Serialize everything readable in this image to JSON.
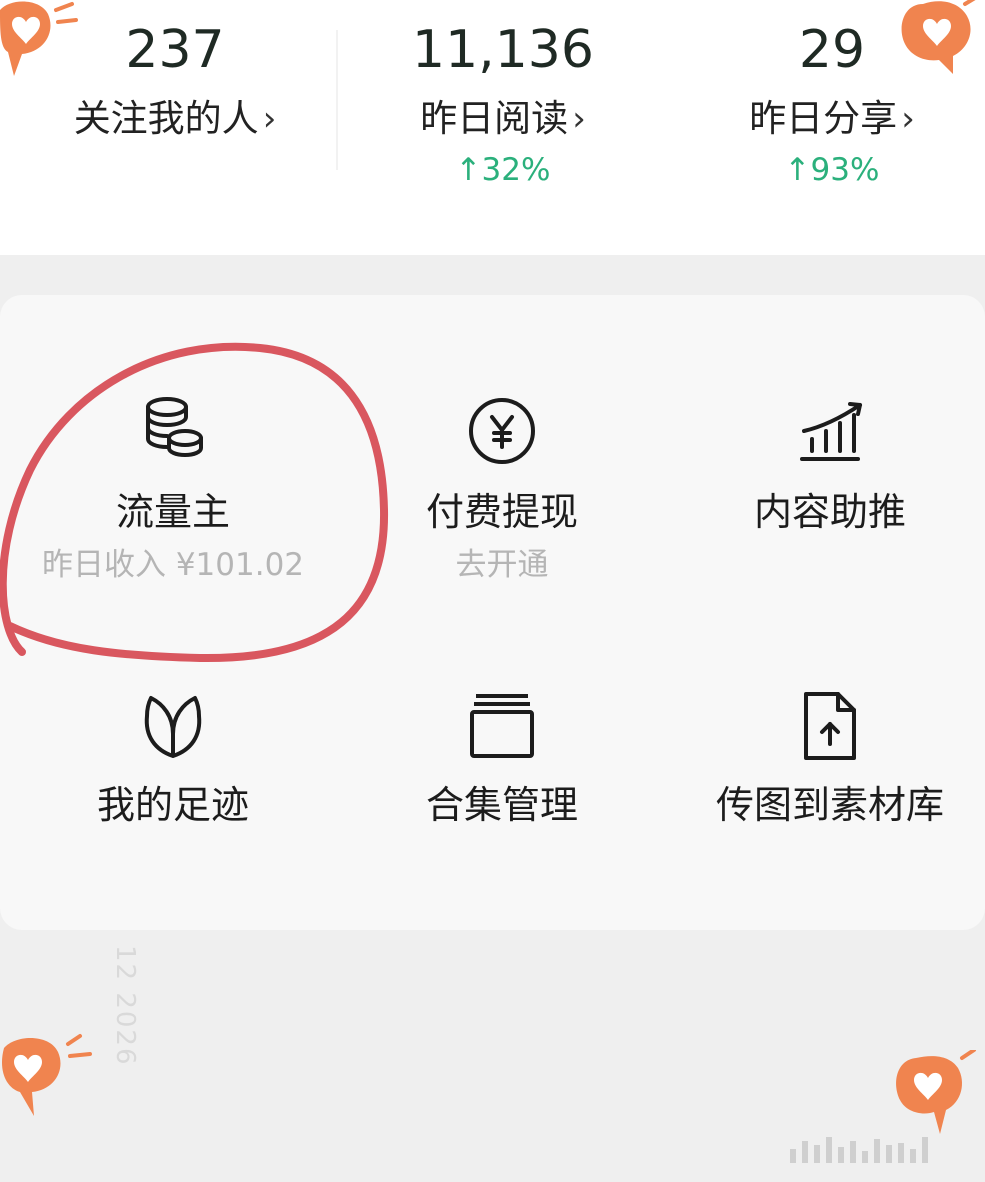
{
  "stats": [
    {
      "value": "237",
      "label": "关注我的人",
      "chevron": "›",
      "delta": ""
    },
    {
      "value": "11,136",
      "label": "昨日阅读",
      "chevron": "›",
      "delta": "↑32%"
    },
    {
      "value": "29",
      "label": "昨日分享",
      "chevron": "›",
      "delta": "↑93%"
    }
  ],
  "tools": [
    {
      "icon": "coins-icon",
      "title": "流量主",
      "subtitle": "昨日收入 ¥101.02"
    },
    {
      "icon": "yen-circle-icon",
      "title": "付费提现",
      "subtitle": "去开通"
    },
    {
      "icon": "growth-chart-icon",
      "title": "内容助推",
      "subtitle": ""
    },
    {
      "icon": "leaf-icon",
      "title": "我的足迹",
      "subtitle": ""
    },
    {
      "icon": "collection-icon",
      "title": "合集管理",
      "subtitle": ""
    },
    {
      "icon": "upload-file-icon",
      "title": "传图到素材库",
      "subtitle": ""
    }
  ],
  "colors": {
    "accent_green": "#2bb07c",
    "annotation_red": "#d9575f",
    "heart_orange": "#f0844f"
  },
  "watermark": "12 2026"
}
